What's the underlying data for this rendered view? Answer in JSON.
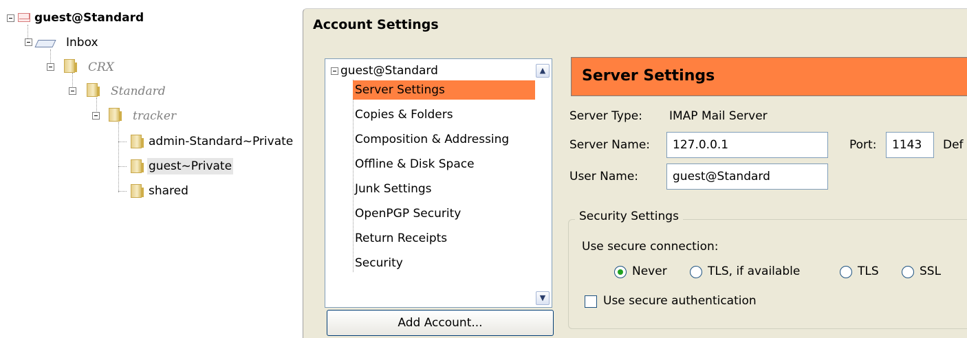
{
  "folder_tree": {
    "account": "guest@Standard",
    "inbox": "Inbox",
    "crx": "CRX",
    "standard": "Standard",
    "tracker": "tracker",
    "admin_private": "admin-Standard~Private",
    "guest_private": "guest~Private",
    "shared": "shared"
  },
  "dialog": {
    "title": "Account Settings",
    "account_tree": {
      "root": "guest@Standard",
      "items": [
        "Server Settings",
        "Copies & Folders",
        "Composition & Addressing",
        "Offline & Disk Space",
        "Junk Settings",
        "OpenPGP Security",
        "Return Receipts",
        "Security"
      ],
      "selected": "Server Settings"
    },
    "add_account_label": "Add Account...",
    "server_settings": {
      "header": "Server Settings",
      "server_type_label": "Server Type:",
      "server_type_value": "IMAP Mail Server",
      "server_name_label": "Server Name:",
      "server_name_value": "127.0.0.1",
      "port_label": "Port:",
      "port_value": "1143",
      "default_label_partial": "Def",
      "user_name_label": "User Name:",
      "user_name_value": "guest@Standard",
      "security_group_label": "Security Settings",
      "use_secure_connection_label": "Use secure connection:",
      "radio_options": [
        "Never",
        "TLS, if available",
        "TLS",
        "SSL"
      ],
      "selected_option": "Never",
      "secure_auth_label": "Use secure authentication",
      "secure_auth_checked": false
    }
  },
  "colors": {
    "selection": "#ff8040",
    "dialog_bg": "#ece9d8"
  }
}
